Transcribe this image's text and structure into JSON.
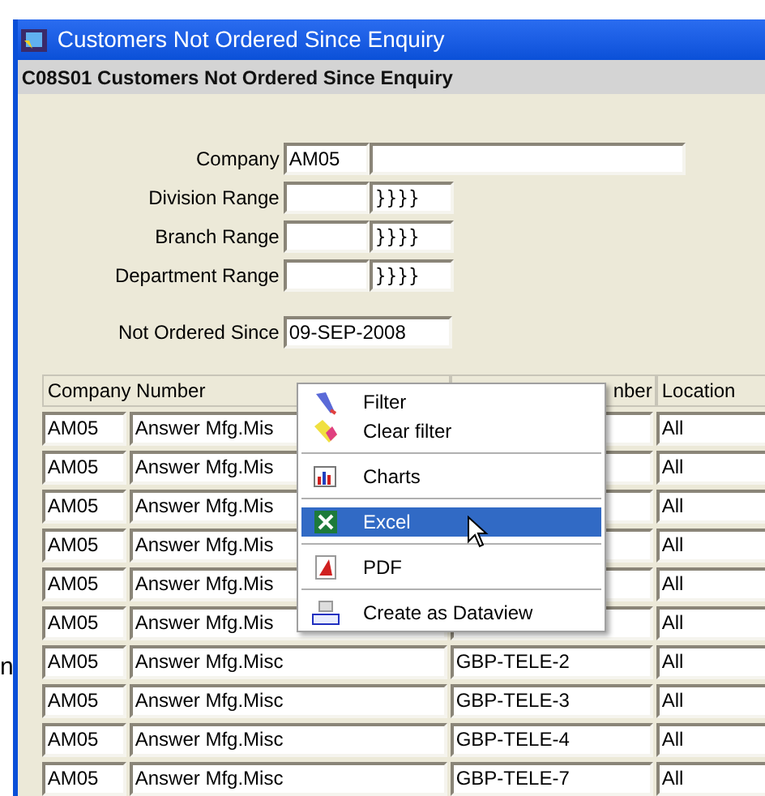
{
  "window": {
    "title": "Customers Not Ordered Since Enquiry"
  },
  "subtitle": "C08S01 Customers Not Ordered Since Enquiry",
  "outside_text": "n",
  "form": [
    {
      "label": "Company",
      "kind": "pair",
      "from": "AM05"
    },
    {
      "label": "Division Range",
      "kind": "range",
      "to": "}}}}"
    },
    {
      "label": "Branch Range",
      "kind": "range",
      "to": "}}}}"
    },
    {
      "label": "Department Range",
      "kind": "range",
      "to": "}}}}"
    },
    {
      "label": "Not Ordered Since",
      "kind": "single",
      "from": "09-SEP-2008"
    }
  ],
  "table": {
    "columns": [
      "Company Number",
      null,
      "nber",
      "Location"
    ],
    "rows": [
      [
        "AM05",
        "Answer Mfg.Mis",
        "",
        "All"
      ],
      [
        "AM05",
        "Answer Mfg.Mis",
        "",
        "All"
      ],
      [
        "AM05",
        "Answer Mfg.Mis",
        "",
        "All"
      ],
      [
        "AM05",
        "Answer Mfg.Mis",
        "",
        "All"
      ],
      [
        "AM05",
        "Answer Mfg.Mis",
        "",
        "All"
      ],
      [
        "AM05",
        "Answer Mfg.Mis",
        "",
        "All"
      ],
      [
        "AM05",
        "Answer Mfg.Misc",
        "GBP-TELE-2",
        "All"
      ],
      [
        "AM05",
        "Answer Mfg.Misc",
        "GBP-TELE-3",
        "All"
      ],
      [
        "AM05",
        "Answer Mfg.Misc",
        "GBP-TELE-4",
        "All"
      ],
      [
        "AM05",
        "Answer Mfg.Misc",
        "GBP-TELE-7",
        "All"
      ]
    ]
  },
  "context_menu": [
    {
      "label": "Filter",
      "kind": "filter",
      "selected": false,
      "separator_after": false
    },
    {
      "label": "Clear filter",
      "kind": "clear",
      "selected": false,
      "separator_after": true
    },
    {
      "label": "Charts",
      "kind": "charts",
      "selected": false,
      "separator_after": true
    },
    {
      "label": "Excel",
      "kind": "excel",
      "selected": true,
      "separator_after": true
    },
    {
      "label": "PDF",
      "kind": "pdf",
      "selected": false,
      "separator_after": true
    },
    {
      "label": "Create as Dataview",
      "kind": "sql",
      "selected": false,
      "separator_after": false
    }
  ]
}
